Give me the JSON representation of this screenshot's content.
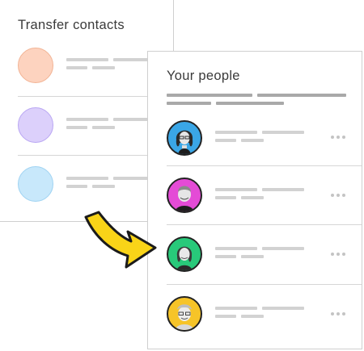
{
  "back_card": {
    "title": "Transfer contacts",
    "contacts": [
      {
        "color": "#fdd3bf",
        "border": "#f2b394"
      },
      {
        "color": "#dcd0fb",
        "border": "#b9a6f3"
      },
      {
        "color": "#c8e8fb",
        "border": "#9fd3f2"
      }
    ]
  },
  "front_card": {
    "title": "Your people",
    "people": [
      {
        "avatar_icon": "person-photo-icon",
        "bg": "#3aa6e6"
      },
      {
        "avatar_icon": "person-photo-icon",
        "bg": "#e44bd6"
      },
      {
        "avatar_icon": "person-photo-icon",
        "bg": "#28c97a"
      },
      {
        "avatar_icon": "person-photo-icon",
        "bg": "#f6c428"
      }
    ]
  },
  "arrow": {
    "icon": "curved-arrow-icon",
    "color": "#f9d418"
  }
}
